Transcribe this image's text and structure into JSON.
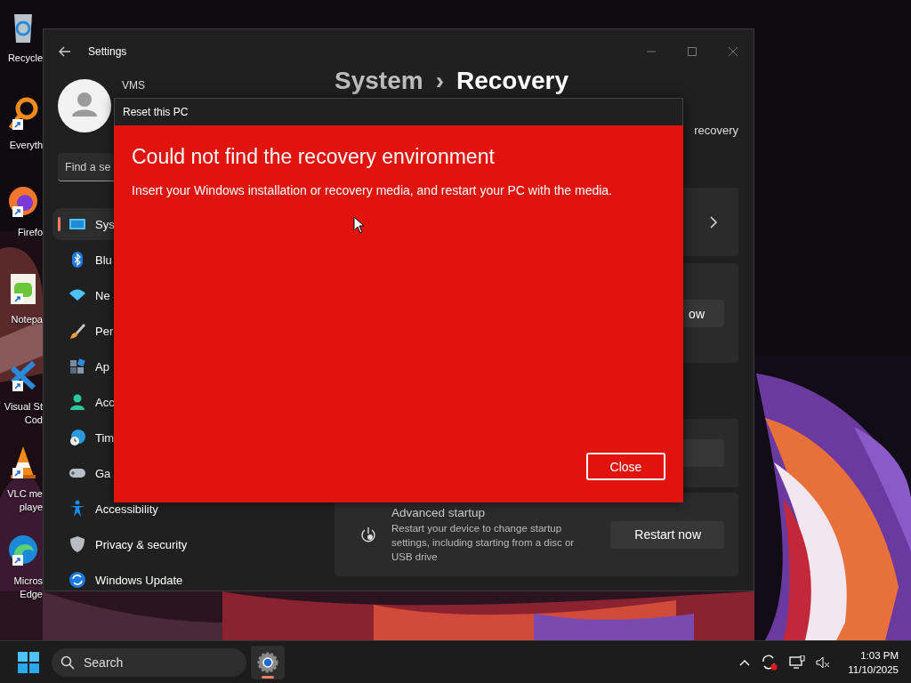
{
  "desktop": {
    "icons": [
      {
        "kind": "recycle-bin",
        "shortcut": false,
        "lines": [
          "Recycle"
        ]
      },
      {
        "kind": "magnifier",
        "shortcut": true,
        "lines": [
          "Everyth"
        ]
      },
      {
        "kind": "firefox",
        "shortcut": true,
        "lines": [
          "Firefo"
        ]
      },
      {
        "kind": "notepad",
        "shortcut": true,
        "lines": [
          "Notepa"
        ]
      },
      {
        "kind": "code",
        "shortcut": true,
        "lines": [
          "Visual St",
          "Cod"
        ]
      },
      {
        "kind": "cone",
        "shortcut": true,
        "lines": [
          "VLC me",
          "playe"
        ]
      },
      {
        "kind": "edge",
        "shortcut": true,
        "lines": [
          "Micros",
          "Edge"
        ]
      }
    ]
  },
  "settings": {
    "title": "Settings",
    "user_name": "VMS",
    "search": {
      "placeholder": "Find a se"
    },
    "nav": [
      {
        "kind": "system",
        "label": "Sys",
        "selected": true
      },
      {
        "kind": "bluetooth",
        "label": "Blu",
        "selected": false
      },
      {
        "kind": "network",
        "label": "Ne",
        "selected": false
      },
      {
        "kind": "brush",
        "label": "Per",
        "selected": false
      },
      {
        "kind": "apps",
        "label": "Ap",
        "selected": false
      },
      {
        "kind": "accounts",
        "label": "Acc",
        "selected": false
      },
      {
        "kind": "time",
        "label": "Tim",
        "selected": false
      },
      {
        "kind": "gaming",
        "label": "Ga",
        "selected": false
      },
      {
        "kind": "accessibility",
        "label": "Accessibility",
        "selected": false
      },
      {
        "kind": "privacy",
        "label": "Privacy & security",
        "selected": false
      },
      {
        "kind": "update",
        "label": "Windows Update",
        "selected": false
      }
    ],
    "breadcrumb": {
      "parent": "System",
      "separator": "›",
      "current": "Recovery"
    },
    "subtitle": "recovery",
    "cards": [
      {
        "kind": "link"
      },
      {
        "kind": "button",
        "button": "ow"
      },
      {
        "kind": "blank-button"
      },
      {
        "kind": "action",
        "title": "Advanced startup",
        "description": "Restart your device to change startup settings, including starting from a disc or USB drive",
        "button": "Restart now"
      }
    ]
  },
  "dialog": {
    "title": "Reset this PC",
    "heading": "Could not find the recovery environment",
    "message": "Insert your Windows installation or recovery media, and restart your PC with the media.",
    "button": "Close"
  },
  "taskbar": {
    "search": "Search",
    "apps": [
      {
        "kind": "settings",
        "active": true
      }
    ],
    "time": "1:03 PM",
    "date": "11/10/2025"
  }
}
